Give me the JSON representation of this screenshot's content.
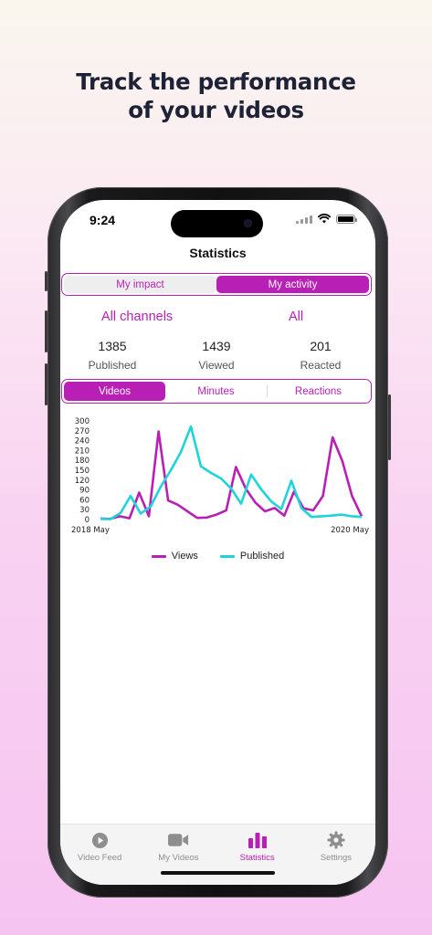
{
  "headline": {
    "line1": "Track the performance",
    "line2": "of your videos"
  },
  "status_bar": {
    "time": "9:24"
  },
  "nav": {
    "title": "Statistics"
  },
  "mode_toggle": {
    "options": [
      "My impact",
      "My activity"
    ],
    "selected": "My activity"
  },
  "filters": {
    "channel": "All channels",
    "scope": "All"
  },
  "stats": [
    {
      "value": "1385",
      "label": "Published"
    },
    {
      "value": "1439",
      "label": "Viewed"
    },
    {
      "value": "201",
      "label": "Reacted"
    }
  ],
  "metric_toggle": {
    "options": [
      "Videos",
      "Minutes",
      "Reactions"
    ],
    "selected": "Videos"
  },
  "chart_data": {
    "type": "line",
    "title": "",
    "xlabel": "",
    "ylabel": "",
    "x_start_label": "2018 May",
    "x_end_label": "2020 May",
    "ylim": [
      0,
      300
    ],
    "yticks": [
      "300",
      "270",
      "240",
      "210",
      "180",
      "150",
      "120",
      "90",
      "60",
      "30",
      "0"
    ],
    "series": [
      {
        "name": "Views",
        "color": "#b81fb5",
        "values": [
          3,
          2,
          10,
          4,
          82,
          10,
          268,
          58,
          45,
          25,
          5,
          6,
          15,
          28,
          160,
          95,
          52,
          25,
          35,
          12,
          85,
          34,
          28,
          72,
          250,
          178,
          72,
          10
        ]
      },
      {
        "name": "Published",
        "color": "#1ed3da",
        "values": [
          2,
          1,
          20,
          72,
          18,
          40,
          100,
          150,
          205,
          283,
          162,
          142,
          125,
          95,
          48,
          137,
          92,
          55,
          32,
          118,
          35,
          8,
          10,
          12,
          15,
          10,
          8
        ]
      }
    ],
    "legend_position": "bottom"
  },
  "tabbar": {
    "items": [
      {
        "label": "Video Feed",
        "icon": "play-circle-icon"
      },
      {
        "label": "My Videos",
        "icon": "video-camera-icon"
      },
      {
        "label": "Statistics",
        "icon": "bar-chart-icon"
      },
      {
        "label": "Settings",
        "icon": "gear-icon"
      }
    ],
    "selected": "Statistics"
  },
  "colors": {
    "accent": "#b81fb5",
    "published": "#1ed3da",
    "headline": "#1e2236"
  }
}
